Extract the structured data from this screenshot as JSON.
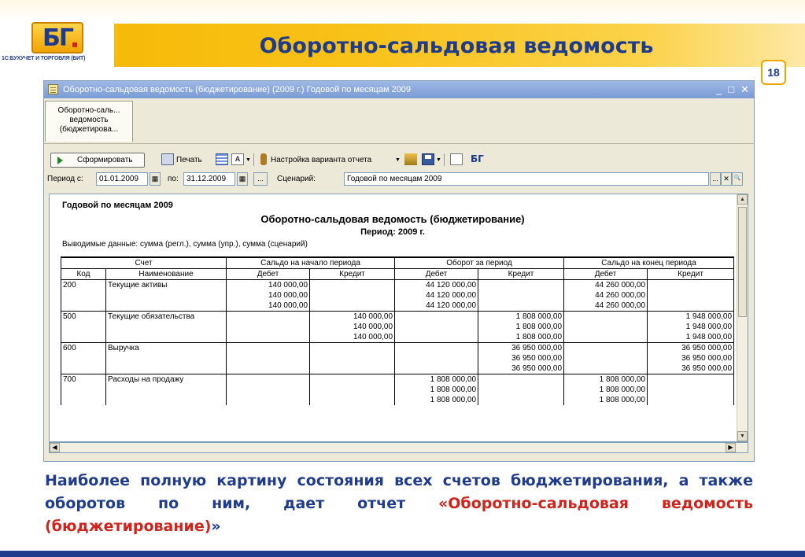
{
  "slide": {
    "logo_text": "БГ",
    "logo_caption": "1С:БУХУЧЕТ И ТОРГОВЛЯ (БИТ)",
    "title": "Оборотно-сальдовая ведомость",
    "page_number": "18",
    "caption_part1": "Наиболее полную картину состояния всех счетов бюджетирования, а также оборотов по ним, дает отчет ",
    "caption_part2": "«Оборотно-сальдовая ведомость (бюджетирование)",
    "caption_part3": "»",
    "colors": {
      "brand_blue": "#1f3b8c",
      "accent_yellow": "#f5b700",
      "highlight_red": "#d0231c"
    }
  },
  "window": {
    "title": "Оборотно-сальдовая ведомость (бюджетирование) (2009 г.) Годовой по месяцам 2009",
    "controls": [
      "_",
      "□",
      "✕"
    ],
    "tab_label_1": "Оборотно-саль...",
    "tab_label_2": "ведомость",
    "tab_label_3": "(бюджетирова..."
  },
  "toolbar": {
    "generate_label": "Сформировать",
    "print_label": "Печать",
    "settings_label": "Настройка варианта отчета",
    "icons": [
      "play-icon",
      "print-icon",
      "grid-icon",
      "font-icon",
      "key-icon",
      "upload-icon",
      "save-icon",
      "pin-icon",
      "bit-logo-icon"
    ]
  },
  "period": {
    "from_label": "Период с:",
    "from_value": "01.01.2009",
    "to_label": "по:",
    "to_value": "31.12.2009",
    "ellipsis_label": "...",
    "scenario_label": "Сценарий:",
    "scenario_value": "Годовой по месяцам 2009",
    "scenario_btn_dots": "...",
    "scenario_btn_clear": "✕",
    "scenario_btn_search": "🔍"
  },
  "report": {
    "subtitle": "Годовой по месяцам 2009",
    "title": "Оборотно-сальдовая ведомость (бюджетирование)",
    "period": "Период: 2009 г.",
    "output_data": "Выводимые данные: сумма (регл.), сумма (упр.), сумма (сценарий)",
    "header1": [
      "Счет",
      "Сальдо на начало периода",
      "Оборот за период",
      "Сальдо на конец периода"
    ],
    "header2": [
      "Код",
      "Наименование",
      "Дебет",
      "Кредит",
      "Дебет",
      "Кредит",
      "Дебет",
      "Кредит"
    ],
    "rows": [
      {
        "code": "200",
        "name": "Текущие активы",
        "d1": "140 000,00",
        "k1": "",
        "d2": "44 120 000,00",
        "k2": "",
        "d3": "44 260 000,00",
        "k3": ""
      },
      {
        "code": "",
        "name": "",
        "d1": "140 000,00",
        "k1": "",
        "d2": "44 120 000,00",
        "k2": "",
        "d3": "44 260 000,00",
        "k3": ""
      },
      {
        "code": "",
        "name": "",
        "d1": "140 000,00",
        "k1": "",
        "d2": "44 120 000,00",
        "k2": "",
        "d3": "44 260 000,00",
        "k3": ""
      },
      {
        "code": "500",
        "name": "Текущие обязательства",
        "d1": "",
        "k1": "140 000,00",
        "d2": "",
        "k2": "1 808 000,00",
        "d3": "",
        "k3": "1 948 000,00"
      },
      {
        "code": "",
        "name": "",
        "d1": "",
        "k1": "140 000,00",
        "d2": "",
        "k2": "1 808 000,00",
        "d3": "",
        "k3": "1 948 000,00"
      },
      {
        "code": "",
        "name": "",
        "d1": "",
        "k1": "140 000,00",
        "d2": "",
        "k2": "1 808 000,00",
        "d3": "",
        "k3": "1 948 000,00"
      },
      {
        "code": "600",
        "name": "Выручка",
        "d1": "",
        "k1": "",
        "d2": "",
        "k2": "36 950 000,00",
        "d3": "",
        "k3": "36 950 000,00"
      },
      {
        "code": "",
        "name": "",
        "d1": "",
        "k1": "",
        "d2": "",
        "k2": "36 950 000,00",
        "d3": "",
        "k3": "36 950 000,00"
      },
      {
        "code": "",
        "name": "",
        "d1": "",
        "k1": "",
        "d2": "",
        "k2": "36 950 000,00",
        "d3": "",
        "k3": "36 950 000,00"
      },
      {
        "code": "700",
        "name": "Расходы на продажу",
        "d1": "",
        "k1": "",
        "d2": "1 808 000,00",
        "k2": "",
        "d3": "1 808 000,00",
        "k3": ""
      },
      {
        "code": "",
        "name": "",
        "d1": "",
        "k1": "",
        "d2": "1 808 000,00",
        "k2": "",
        "d3": "1 808 000,00",
        "k3": ""
      },
      {
        "code": "",
        "name": "",
        "d1": "",
        "k1": "",
        "d2": "1 808 000,00",
        "k2": "",
        "d3": "1 808 000,00",
        "k3": ""
      }
    ]
  }
}
